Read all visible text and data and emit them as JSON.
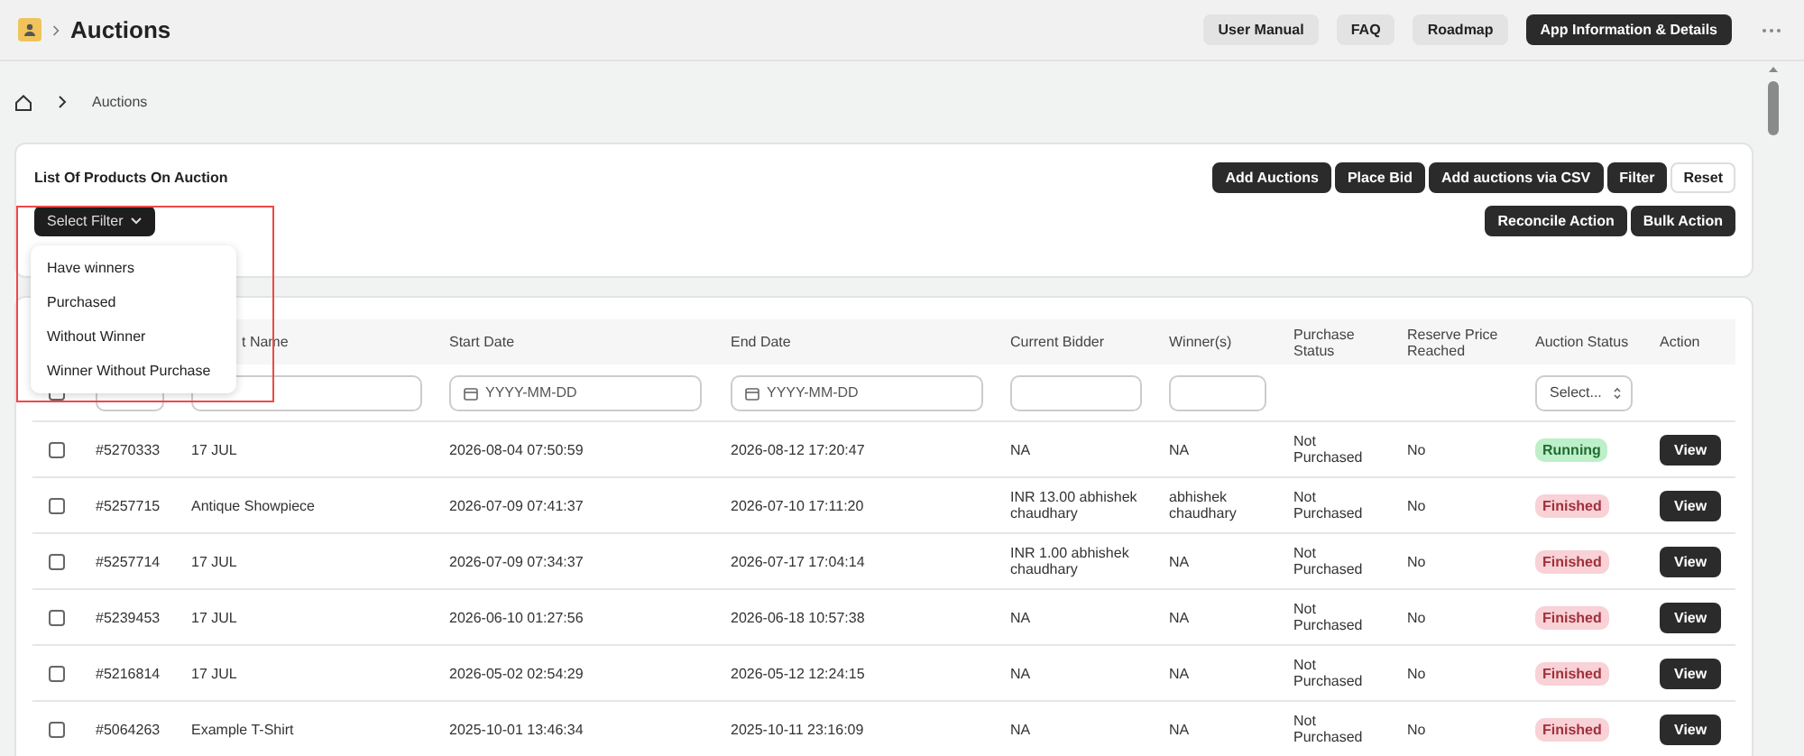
{
  "topbar": {
    "title": "Auctions",
    "buttons": [
      {
        "label": "User Manual",
        "primary": false
      },
      {
        "label": "FAQ",
        "primary": false
      },
      {
        "label": "Roadmap",
        "primary": false
      },
      {
        "label": "App Information & Details",
        "primary": true
      }
    ]
  },
  "breadcrumb": {
    "current": "Auctions"
  },
  "toolbar_card": {
    "title": "List Of Products On Auction",
    "filter_button": "Select Filter",
    "actions": [
      {
        "label": "Add Auctions",
        "primary": true
      },
      {
        "label": "Place Bid",
        "primary": true
      },
      {
        "label": "Add auctions via CSV",
        "primary": true
      },
      {
        "label": "Filter",
        "primary": true
      },
      {
        "label": "Reset",
        "primary": false
      }
    ],
    "actions_2": [
      {
        "label": "Reconcile Action",
        "primary": true
      },
      {
        "label": "Bulk Action",
        "primary": true
      }
    ]
  },
  "filter_menu": {
    "items": [
      "Have winners",
      "Purchased",
      "Without Winner",
      "Winner Without Purchase"
    ]
  },
  "table": {
    "columns": [
      "t Name",
      "Start Date",
      "End Date",
      "Current Bidder",
      "Winner(s)",
      "Purchase Status",
      "Reserve Price Reached",
      "Auction Status",
      "Action"
    ],
    "filters": {
      "select_all_checked": false,
      "start_placeholder": "YYYY-MM-DD",
      "end_placeholder": "YYYY-MM-DD",
      "status_placeholder": "Select..."
    },
    "rows": [
      {
        "checked": false,
        "id": "#5270333",
        "name": "17 JUL",
        "start": "2026-08-04 07:50:59",
        "end": "2026-08-12 17:20:47",
        "bidder": "NA",
        "winner": "NA",
        "purchase": "Not Purchased",
        "reserve": "No",
        "status": {
          "label": "Running",
          "kind": "running"
        },
        "action": "View"
      },
      {
        "checked": false,
        "id": "#5257715",
        "name": "Antique Showpiece",
        "start": "2026-07-09 07:41:37",
        "end": "2026-07-10 17:11:20",
        "bidder": "INR 13.00 abhishek chaudhary",
        "winner": "abhishek chaudhary",
        "purchase": "Not Purchased",
        "reserve": "No",
        "status": {
          "label": "Finished",
          "kind": "finished"
        },
        "action": "View"
      },
      {
        "checked": false,
        "id": "#5257714",
        "name": "17 JUL",
        "start": "2026-07-09 07:34:37",
        "end": "2026-07-17 17:04:14",
        "bidder": "INR 1.00 abhishek chaudhary",
        "winner": "NA",
        "purchase": "Not Purchased",
        "reserve": "No",
        "status": {
          "label": "Finished",
          "kind": "finished"
        },
        "action": "View"
      },
      {
        "checked": false,
        "id": "#5239453",
        "name": "17 JUL",
        "start": "2026-06-10 01:27:56",
        "end": "2026-06-18 10:57:38",
        "bidder": "NA",
        "winner": "NA",
        "purchase": "Not Purchased",
        "reserve": "No",
        "status": {
          "label": "Finished",
          "kind": "finished"
        },
        "action": "View"
      },
      {
        "checked": false,
        "id": "#5216814",
        "name": "17 JUL",
        "start": "2026-05-02 02:54:29",
        "end": "2026-05-12 12:24:15",
        "bidder": "NA",
        "winner": "NA",
        "purchase": "Not Purchased",
        "reserve": "No",
        "status": {
          "label": "Finished",
          "kind": "finished"
        },
        "action": "View"
      },
      {
        "checked": false,
        "id": "#5064263",
        "name": "Example T-Shirt",
        "start": "2025-10-01 13:46:34",
        "end": "2025-10-11 23:16:09",
        "bidder": "NA",
        "winner": "NA",
        "purchase": "Not Purchased",
        "reserve": "No",
        "status": {
          "label": "Finished",
          "kind": "finished"
        },
        "action": "View"
      }
    ]
  }
}
